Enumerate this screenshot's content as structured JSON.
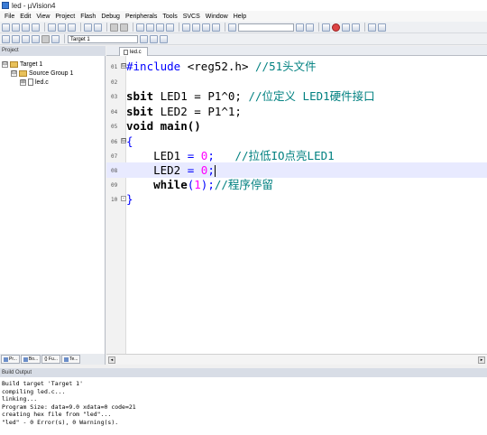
{
  "window": {
    "title": "led - µVision4"
  },
  "menu": [
    "File",
    "Edit",
    "View",
    "Project",
    "Flash",
    "Debug",
    "Peripherals",
    "Tools",
    "SVCS",
    "Window",
    "Help"
  ],
  "toolbar": {
    "target_label": "Target 1"
  },
  "project_panel": {
    "title": "Project",
    "tree": [
      {
        "label": "Target 1",
        "level": 0,
        "expander": "⊟",
        "icon": "folder-icon"
      },
      {
        "label": "Source Group 1",
        "level": 1,
        "expander": "⊟",
        "icon": "folder-icon"
      },
      {
        "label": "led.c",
        "level": 2,
        "expander": "⊞",
        "icon": "file-icon"
      }
    ],
    "tabs": [
      "Pr...",
      "Bo...",
      "{} Fu...",
      "Te..."
    ]
  },
  "editor": {
    "tab_label": "led.c",
    "lines": [
      {
        "num": "01",
        "fold": "⊟"
      },
      {
        "num": "02"
      },
      {
        "num": "03"
      },
      {
        "num": "04"
      },
      {
        "num": "05"
      },
      {
        "num": "06",
        "fold": "⊟"
      },
      {
        "num": "07"
      },
      {
        "num": "08",
        "current": true
      },
      {
        "num": "09"
      },
      {
        "num": "10",
        "fold": "-"
      }
    ],
    "code": {
      "l1_kw": "#include",
      "l1_rest": " <reg52.h> ",
      "l1_cm": "//51头文件",
      "l3_kw": "sbit",
      "l3_rest": " LED1 = P1^0; ",
      "l3_cm": "//位定义 LED1硬件接口",
      "l4_kw": "sbit",
      "l4_rest": " LED2 = P1^1;",
      "l5_text": "void main()",
      "l6_text": "{",
      "l7_a": "    LED1 ",
      "l7_op": "=",
      "l7_num": " 0",
      "l7_b": ";   ",
      "l7_cm": "//拉低IO点亮LED1",
      "l8_a": "    LED2 ",
      "l8_op": "=",
      "l8_num": " 0",
      "l8_b": ";",
      "l9_kw": "    while",
      "l9_open": "(",
      "l9_num": "1",
      "l9_close": ");",
      "l9_cm": "//程序停留",
      "l10_text": "}"
    }
  },
  "build_output": {
    "title": "Build Output",
    "lines": [
      "Build target 'Target 1'",
      "compiling led.c...",
      "linking...",
      "Program Size: data=9.0 xdata=0 code=21",
      "creating hex file from \"led\"...",
      "\"led\" - 0 Error(s), 0 Warning(s)."
    ]
  },
  "colors": {
    "keyword": "#0000ff",
    "comment": "#008080",
    "number": "#ff00ff",
    "current_line": "#e8eaff"
  }
}
